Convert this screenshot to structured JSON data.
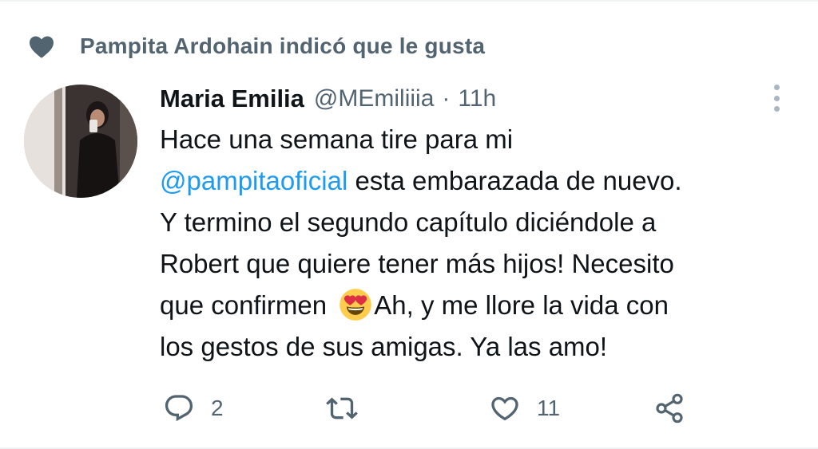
{
  "social_context": {
    "text": "Pampita Ardohain indicó que le gusta",
    "icon": "heart-icon"
  },
  "tweet": {
    "author_name": "Maria Emilia",
    "handle": "@MEmiliiia",
    "separator": "·",
    "time": "11h",
    "avatar": "avatar-photo",
    "text_lines": {
      "l1": "Hace una semana tire para mi",
      "l2_mention": "@pampitaoficial",
      "l2_rest": " esta embarazada de nuevo.",
      "l3": "Y termino el segundo capítulo diciéndole a",
      "l4": "Robert que quiere tener más hijos! Necesito",
      "l5_before": "que confirmen ",
      "l5_emoji": "smiling-face-with-heart-eyes",
      "l5_after": "Ah, y me llore la vida con",
      "l6": "los gestos de sus amigas. Ya las amo!"
    }
  },
  "actions": {
    "reply": {
      "icon": "reply-icon",
      "count": "2"
    },
    "retweet": {
      "icon": "retweet-icon",
      "count": ""
    },
    "like": {
      "icon": "like-icon",
      "count": "11"
    },
    "share": {
      "icon": "share-icon"
    }
  },
  "colors": {
    "text_primary": "#0f1419",
    "text_secondary": "#536471",
    "link": "#1d9bf0",
    "divider": "#eff3f4"
  }
}
